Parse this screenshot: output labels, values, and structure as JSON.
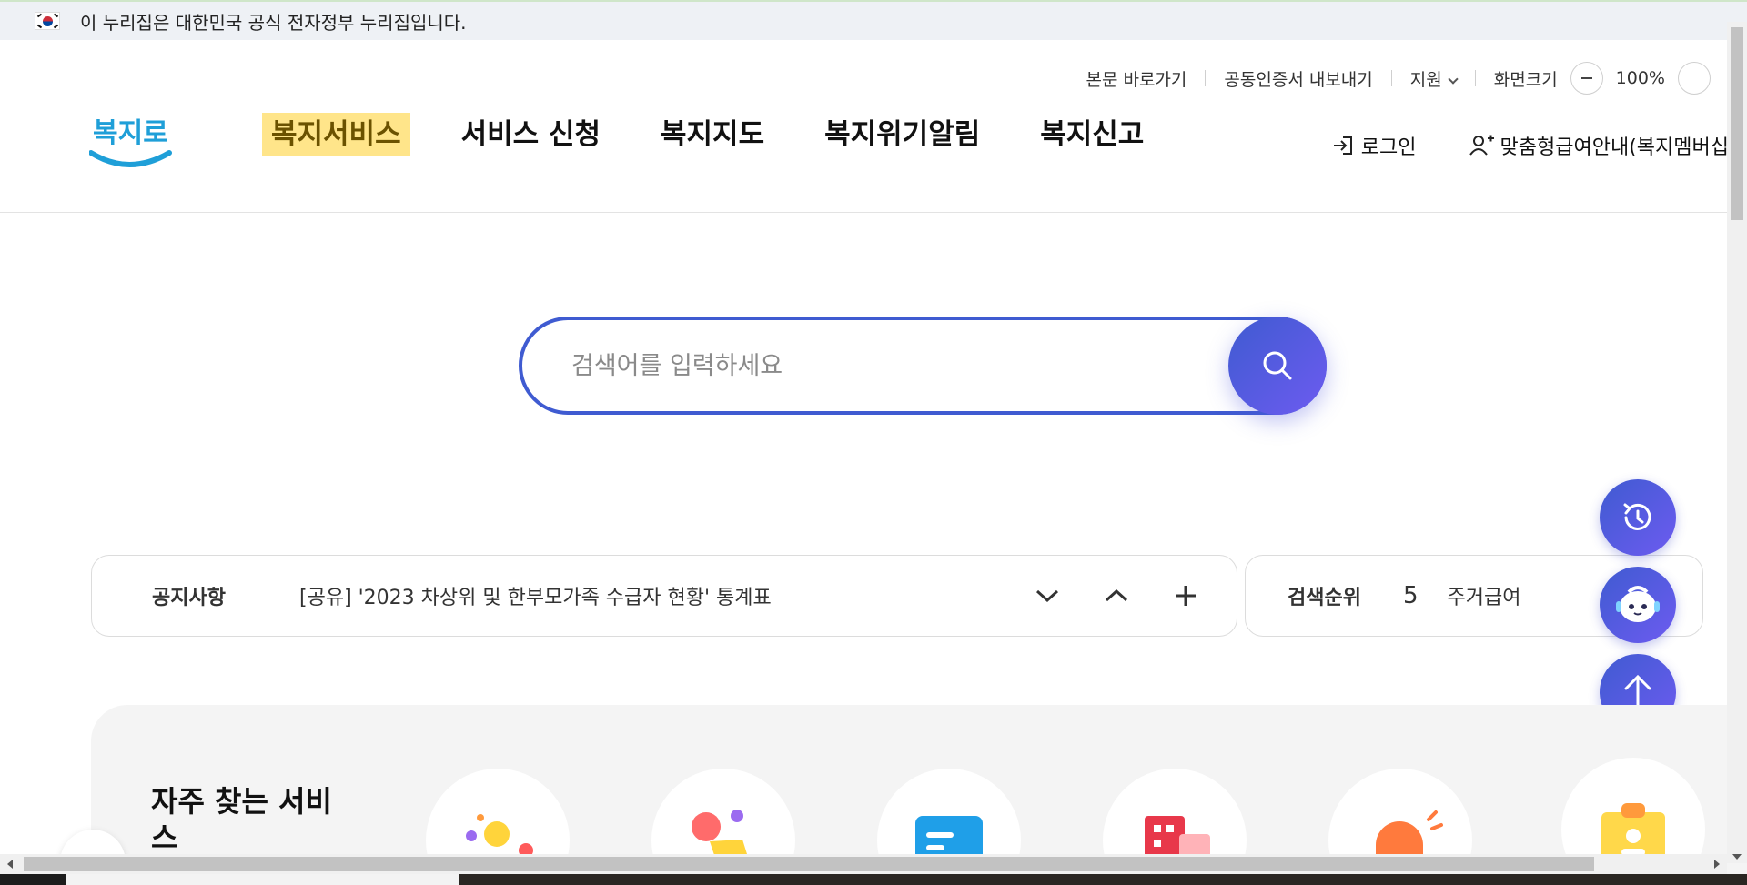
{
  "gov_banner": {
    "text": "이 누리집은 대한민국 공식 전자정부 누리집입니다."
  },
  "utility": {
    "skip_link": "본문 바로가기",
    "cert_export": "공동인증서 내보내기",
    "support": "지원",
    "screen_size_label": "화면크기",
    "zoom_level": "100%"
  },
  "logo": {
    "text": "복지로"
  },
  "nav": {
    "items": [
      {
        "label": "복지서비스",
        "active": true
      },
      {
        "label": "서비스 신청",
        "active": false
      },
      {
        "label": "복지지도",
        "active": false
      },
      {
        "label": "복지위기알림",
        "active": false
      },
      {
        "label": "복지신고",
        "active": false
      }
    ]
  },
  "header_right": {
    "login": "로그인",
    "membership": "맞춤형급여안내(복지멤버십"
  },
  "search": {
    "placeholder": "검색어를 입력하세요",
    "value": ""
  },
  "notice": {
    "label": "공지사항",
    "text": "[공유] '2023 차상위 및 한부모가족 수급자 현황' 통계표"
  },
  "ranking": {
    "label": "검색순위",
    "rank": "5",
    "item": "주거급여"
  },
  "frequent_services": {
    "title": "자주 찾는 서비스"
  },
  "colors": {
    "primary": "#3f5bd1",
    "accent": "#6d5bf0",
    "nav_highlight": "#ffe58a"
  }
}
